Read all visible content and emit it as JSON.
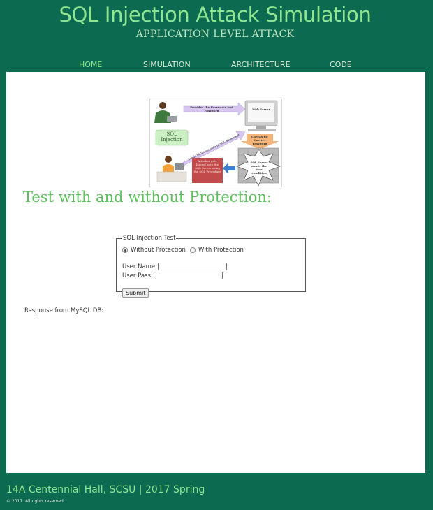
{
  "header": {
    "title": "SQL Injection Attack Simulation",
    "subtitle": "APPLICATION LEVEL ATTACK"
  },
  "nav": {
    "items": [
      {
        "label": "HOME",
        "active": true
      },
      {
        "label": "SIMULATION",
        "active": false
      },
      {
        "label": "ARCHITECTURE",
        "active": false
      },
      {
        "label": "CODE",
        "active": false
      }
    ]
  },
  "diagram": {
    "arrow_top": "Provides the Username and Password",
    "web_server": "Web Server",
    "sql_injection": "SQL Injection",
    "diagonal": "Sends Malicious code in SQL Statement",
    "checks": "Checks for Correct Password",
    "attacker": "Attacker gets logged in to the SQL Server using the SQL Procedure",
    "burst": "SQL Server meets the true condition"
  },
  "main": {
    "heading": "Test with and without Protection:",
    "form": {
      "legend": "SQL Injection Test",
      "option_without": "Without Protection",
      "option_with": "With Protection",
      "selected": "Without Protection",
      "username_label": "User Name:",
      "username_value": "",
      "password_label": "User Pass:",
      "password_value": "",
      "submit_label": "Submit"
    },
    "response_label": "Response from MySQL DB:"
  },
  "footer": {
    "address": "14A Centennial Hall, SCSU | 2017 Spring",
    "copyright": "© 2017. All rights reserved."
  },
  "colors": {
    "background": "#0b6a50",
    "accent": "#8fe58f",
    "heading_green": "#5cc15c"
  }
}
